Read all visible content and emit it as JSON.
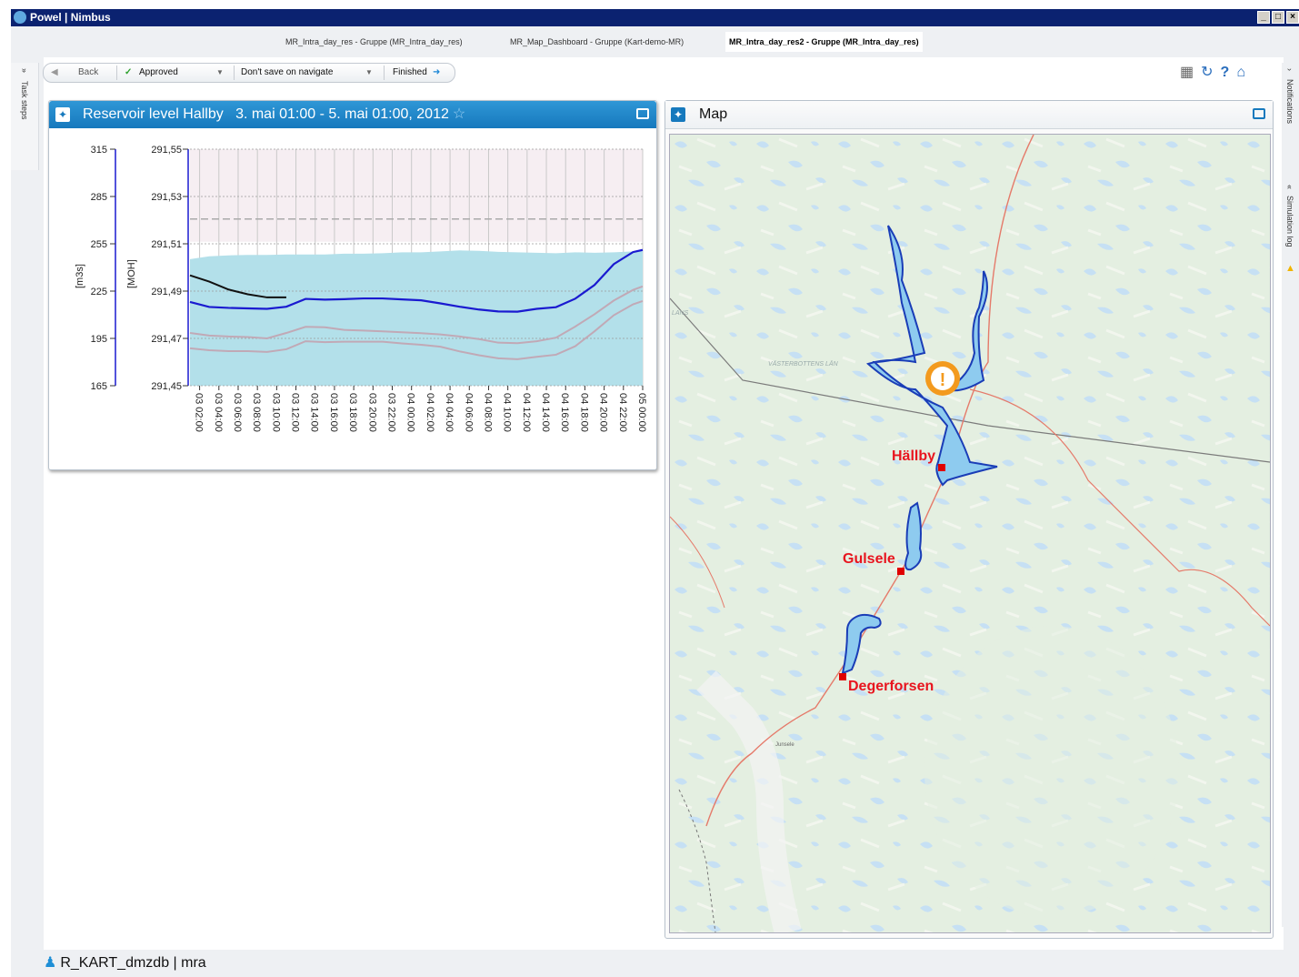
{
  "window": {
    "title": "Powel | Nimbus"
  },
  "tabs": [
    {
      "label": "MR_Intra_day_res -  Gruppe (MR_Intra_day_res)"
    },
    {
      "label": "MR_Map_Dashboard -  Gruppe (Kart-demo-MR)"
    },
    {
      "label": "MR_Intra_day_res2 -  Gruppe (MR_Intra_day_res)"
    }
  ],
  "side": {
    "task_steps": "Task steps",
    "notifications": "Notifications",
    "simulation_log": "Simulation log"
  },
  "toolbar": {
    "back": "Back",
    "approved": "Approved",
    "save_mode": "Don't save on navigate",
    "finished": "Finished"
  },
  "reservoir_panel": {
    "title": "Reservoir level Hallby",
    "period": "3. mai 01:00 - 5. mai 01:00, 2012"
  },
  "map_panel": {
    "title": "Map"
  },
  "map": {
    "labels": {
      "hallby": "Hällby",
      "gulsele": "Gulsele",
      "degerforsen": "Degerforsen",
      "area1": "LANS",
      "area2": "VÄSTERBOTTENS LÄN",
      "town": "Junsele"
    },
    "colors": {
      "water": "#8ecbef",
      "water_edge": "#1a3db7",
      "plant": "#e00000",
      "label": "#e8141e",
      "warning": "#f39a1e",
      "road": "#e57a6a",
      "land": "#e4efe1"
    }
  },
  "chart_data": {
    "type": "area",
    "categories": [
      "03 02:00",
      "03 04:00",
      "03 06:00",
      "03 08:00",
      "03 10:00",
      "03 12:00",
      "03 14:00",
      "03 16:00",
      "03 18:00",
      "03 20:00",
      "03 22:00",
      "04 00:00",
      "04 02:00",
      "04 04:00",
      "04 06:00",
      "04 08:00",
      "04 10:00",
      "04 12:00",
      "04 14:00",
      "04 16:00",
      "04 18:00",
      "04 20:00",
      "04 22:00",
      "05 00:00"
    ],
    "ylabel_left": "[m3s]",
    "ylabel_right": "[MOH]",
    "left_ticks": [
      "315",
      "285",
      "255",
      "225",
      "195",
      "165"
    ],
    "right_ticks": [
      "291,55",
      "291,53",
      "291,51",
      "291,49",
      "291,47",
      "291,45"
    ],
    "ylim": [
      291.45,
      291.55
    ],
    "y2lim": [
      165,
      315
    ],
    "dashed_line": 291.5205,
    "x_hours": [
      1,
      3,
      5,
      7,
      9,
      11,
      13,
      15,
      17,
      19,
      21,
      23,
      25,
      27,
      29,
      31,
      33,
      35,
      37,
      39,
      41,
      43,
      45,
      47,
      48
    ],
    "series": [
      {
        "values": [
          291.5035,
          291.5047,
          291.5051,
          291.5053,
          291.5053,
          291.5055,
          291.5055,
          291.5055,
          291.5058,
          291.5058,
          291.506,
          291.5064,
          291.5064,
          291.5068,
          291.5072,
          291.507,
          291.5066,
          291.5064,
          291.5062,
          291.506,
          291.5064,
          291.5062,
          291.5064,
          291.5068,
          291.5072
        ]
      },
      {
        "values": [
          291.4854,
          291.4833,
          291.4829,
          291.4827,
          291.4825,
          291.4834,
          291.4867,
          291.4864,
          291.4866,
          291.4869,
          291.4869,
          291.4865,
          291.4861,
          291.4848,
          291.4834,
          291.4822,
          291.4814,
          291.4813,
          291.4825,
          291.4832,
          291.4868,
          291.4926,
          291.5014,
          291.5065,
          291.5074
        ]
      },
      {
        "values": [
          291.4723,
          291.4712,
          291.4708,
          291.4706,
          291.47,
          291.4723,
          291.4749,
          291.4747,
          291.4736,
          291.4733,
          291.473,
          291.4726,
          291.4722,
          291.4717,
          291.4708,
          291.4697,
          291.4682,
          291.468,
          291.4688,
          291.4703,
          291.475,
          291.4802,
          291.486,
          291.4905,
          291.492
        ]
      },
      {
        "values": [
          291.4658,
          291.465,
          291.4646,
          291.4646,
          291.4643,
          291.4654,
          291.4688,
          291.4684,
          291.4686,
          291.4686,
          291.4686,
          291.4679,
          291.4673,
          291.4665,
          291.4645,
          291.4629,
          291.4616,
          291.4612,
          291.4622,
          291.4631,
          291.4667,
          291.473,
          291.4798,
          291.4844,
          291.4858
        ]
      }
    ],
    "flow_series": {
      "x_hours": [
        1,
        3,
        5,
        7,
        9,
        11
      ],
      "values": [
        235,
        231,
        226,
        223,
        221,
        221
      ]
    }
  }
}
